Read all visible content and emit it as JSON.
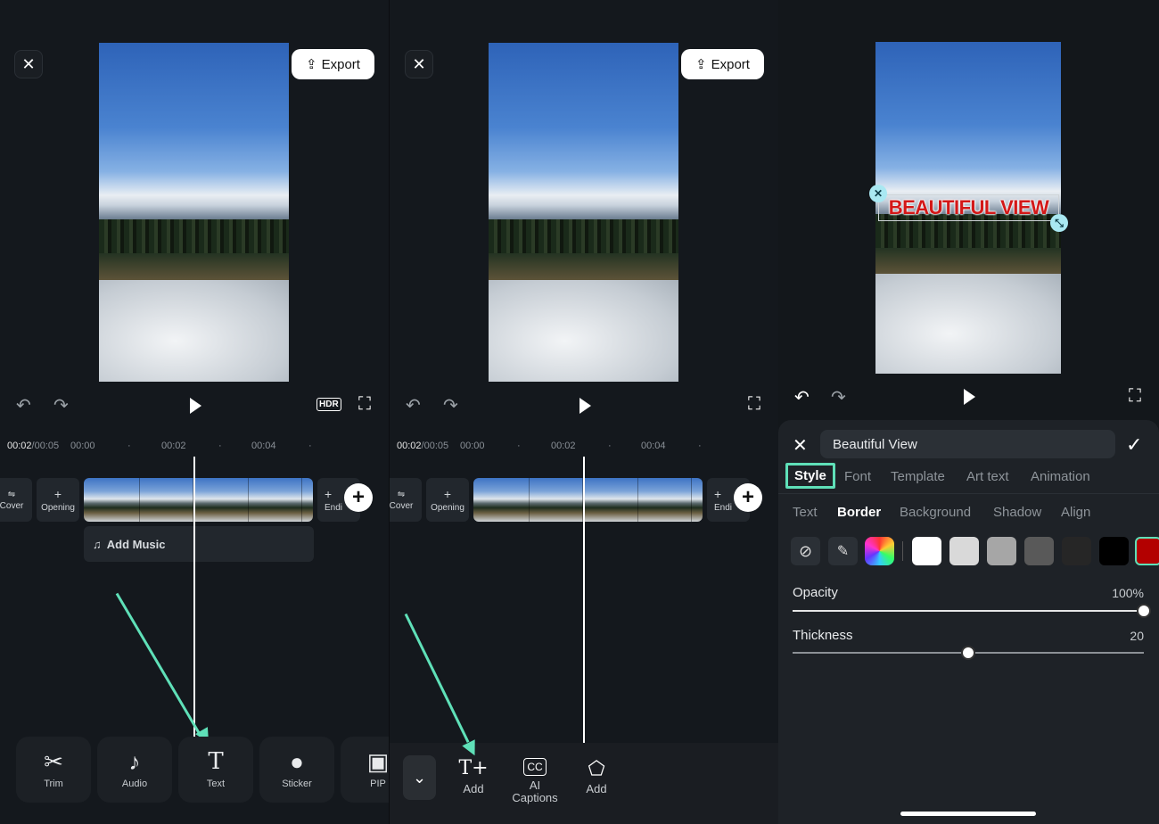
{
  "left": {
    "export_label": "Export",
    "ruler": {
      "current": "00:02",
      "total": "/00:05",
      "t0": "00:00",
      "t2": "00:02",
      "t4": "00:04"
    },
    "cover_label": "Cover",
    "opening_label": "Opening",
    "ending_label": "Endi",
    "add_music_label": "Add Music",
    "tools": [
      {
        "label": "Trim",
        "icon": "scissors-icon"
      },
      {
        "label": "Audio",
        "icon": "music-note-icon"
      },
      {
        "label": "Text",
        "icon": "text-icon"
      },
      {
        "label": "Sticker",
        "icon": "sticker-icon"
      },
      {
        "label": "PIP",
        "icon": "image-icon"
      }
    ]
  },
  "middle": {
    "export_label": "Export",
    "ruler": {
      "current": "00:02",
      "total": "/00:05",
      "t0": "00:00",
      "t2": "00:02",
      "t4": "00:04"
    },
    "cover_label": "Cover",
    "opening_label": "Opening",
    "ending_label": "Endi",
    "tools": [
      {
        "label": "Add",
        "icon": "add-text-icon"
      },
      {
        "label": "AI Captions",
        "icon": "ai-captions-icon"
      },
      {
        "label": "Add",
        "icon": "add-sticker-icon"
      }
    ]
  },
  "right": {
    "overlay_text": "BEAUTIFUL VIEW",
    "text_value": "Beautiful View",
    "tabs": [
      "Style",
      "Font",
      "Template",
      "Art text",
      "Animation"
    ],
    "selected_tab": "Style",
    "subtabs": [
      "Text",
      "Border",
      "Background",
      "Shadow",
      "Align"
    ],
    "selected_subtab": "Border",
    "swatches": [
      "#ffffff",
      "#d9d9d9",
      "#a6a6a6",
      "#595959",
      "#262626",
      "#000000",
      "#b30000"
    ],
    "opacity_label": "Opacity",
    "opacity_value": "100%",
    "opacity_fraction": 1.0,
    "thickness_label": "Thickness",
    "thickness_value": "20",
    "thickness_fraction": 0.5
  },
  "colors": {
    "accent": "#5fe0b8",
    "handle": "#a9e8f2",
    "overlay_text": "#d31818"
  }
}
